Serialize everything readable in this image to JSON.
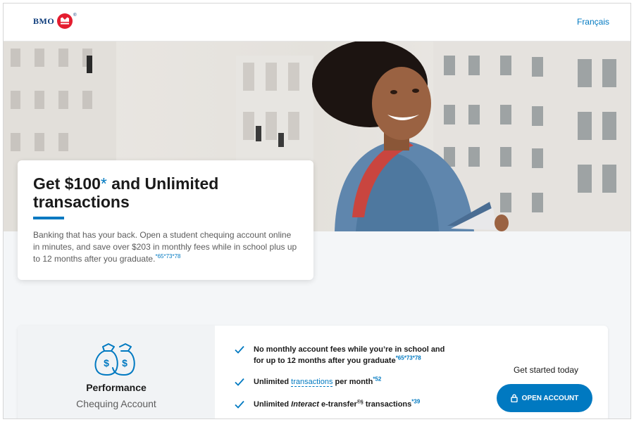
{
  "header": {
    "logo_text": "BMO",
    "logo_reg": "®",
    "language_link": "Français"
  },
  "hero": {
    "title_part1": "Get $100",
    "title_asterisk": "*",
    "title_part2": " and Unlimited transactions",
    "body": "Banking that has your back. Open a student chequing account online in minutes, and save over $203 in monthly fees while in school plus up to 12 months after you graduate.",
    "body_footnotes": "*65*73*78"
  },
  "product": {
    "icon": "money-bags-icon",
    "name": "Performance",
    "type": "Chequing Account",
    "features": [
      {
        "text": "No monthly account fees while you’re in school and for up to 12 months after you graduate",
        "footnotes": "*65*73*78"
      },
      {
        "text_before": "Unlimited ",
        "link": "transactions",
        "text_after": " per month",
        "footnotes": "*52"
      },
      {
        "text_before": "Unlimited ",
        "italic": "Interact",
        "text_after": " e-transfer",
        "reg": "®§",
        "text_after2": " transactions",
        "footnotes": "*39"
      }
    ],
    "cta_heading": "Get started today",
    "cta_button": "OPEN ACCOUNT",
    "cta_icon": "lock-icon"
  },
  "colors": {
    "brand_blue": "#0079c1",
    "brand_red": "#e41d2f",
    "logo_navy": "#0b3a7a"
  }
}
